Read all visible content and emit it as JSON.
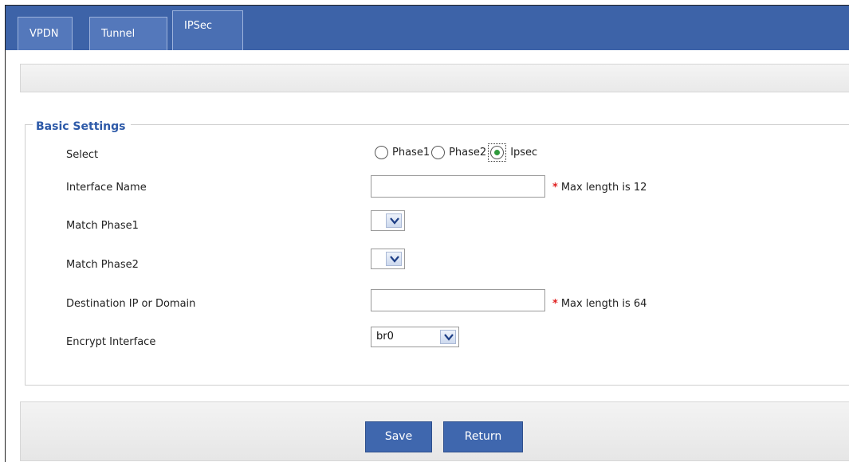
{
  "tabs": [
    {
      "label": "VPDN"
    },
    {
      "label": "Tunnel"
    },
    {
      "label": "IPSec"
    }
  ],
  "basic_settings": {
    "legend": "Basic Settings",
    "select": {
      "label": "Select",
      "options": [
        "Phase1",
        "Phase2",
        "Ipsec"
      ],
      "selected": "Ipsec"
    },
    "interface_name": {
      "label": "Interface Name",
      "value": "",
      "hint": "Max length is 12"
    },
    "match_phase1": {
      "label": "Match Phase1",
      "value": ""
    },
    "match_phase2": {
      "label": "Match Phase2",
      "value": ""
    },
    "destination": {
      "label": "Destination IP or Domain",
      "value": "",
      "hint": "Max length is 64"
    },
    "encrypt_interface": {
      "label": "Encrypt Interface",
      "value": "br0"
    },
    "required_mark": "*"
  },
  "buttons": {
    "save": "Save",
    "return": "Return"
  },
  "colors": {
    "tabbar": "#3d63a8",
    "legend": "#2e5aa8",
    "button": "#3f67ae",
    "required": "#e02020",
    "radio_dot": "#2f9a3c"
  }
}
